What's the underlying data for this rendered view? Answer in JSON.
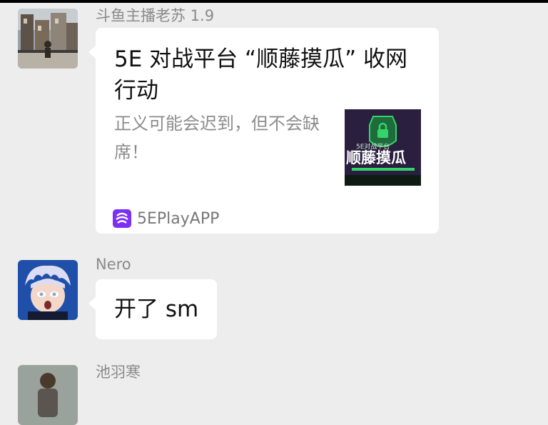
{
  "messages": [
    {
      "sender": "斗鱼主播老苏 1.9",
      "card": {
        "title": "5E 对战平台 “顺藤摸瓜” 收网行动",
        "description": "正义可能会迟到，但不会缺席！",
        "thumbnail_text_top": "5E对战平台",
        "thumbnail_text_main": "顺藤摸瓜",
        "source": "5EPlayAPP",
        "source_icon": "5eplay-app-icon"
      }
    },
    {
      "sender": "Nero",
      "text": "开了 sm"
    },
    {
      "sender": "池羽寒"
    }
  ],
  "colors": {
    "background": "#ededed",
    "bubble": "#ffffff",
    "sender_name": "#8a8a8a",
    "source_icon": "#7b2ff7"
  }
}
